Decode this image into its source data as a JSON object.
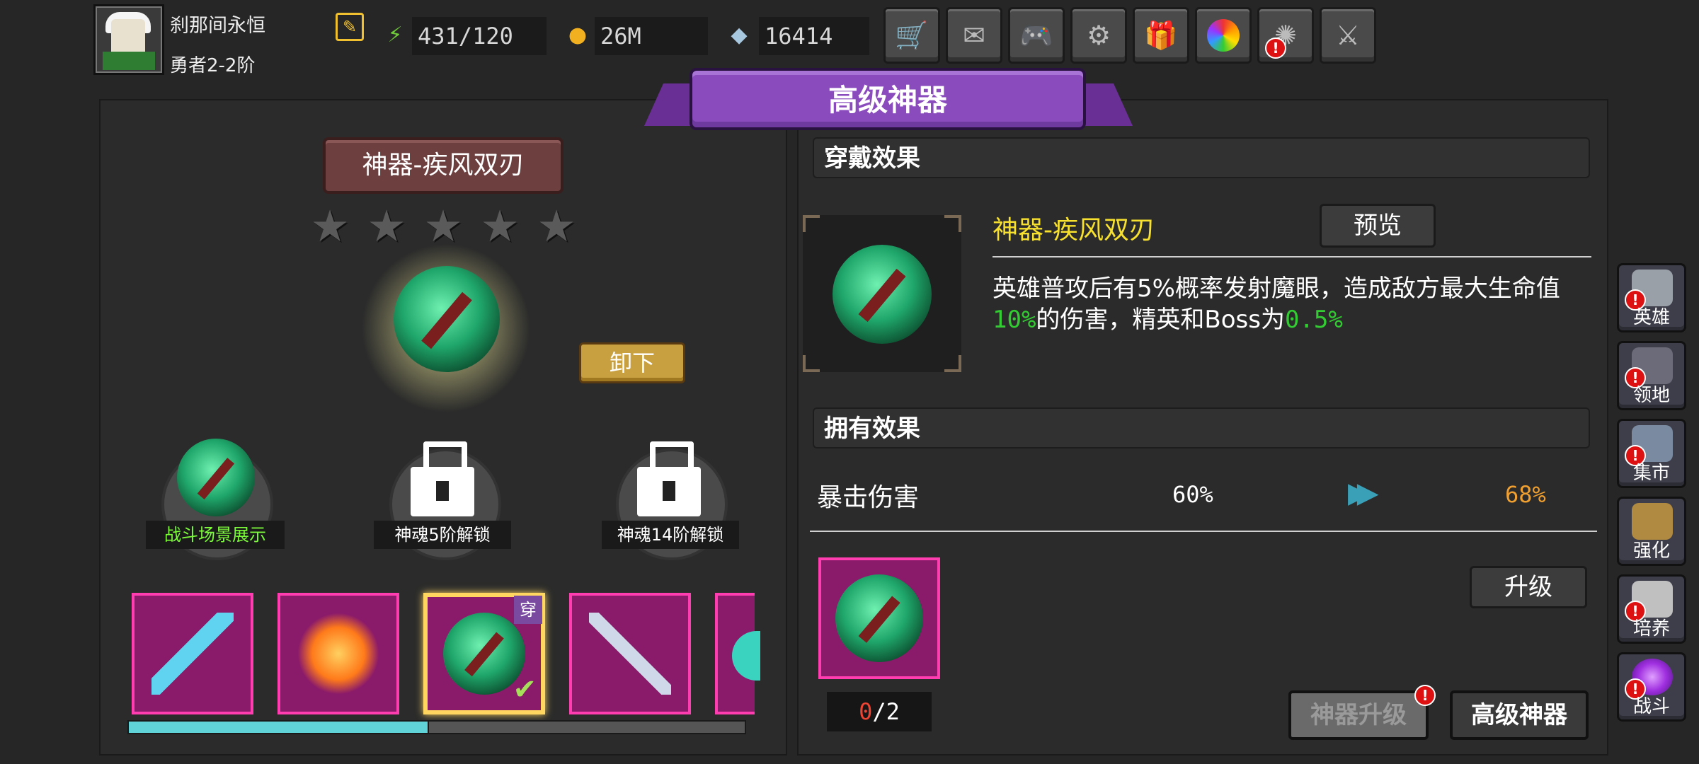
{
  "player": {
    "name": "刹那间永恒",
    "rank": "勇者2-2阶"
  },
  "resources": [
    {
      "icon": "energy-icon",
      "value": "431/120"
    },
    {
      "icon": "gold-coin-icon",
      "value": "26M"
    },
    {
      "icon": "diamond-icon",
      "value": "16414"
    }
  ],
  "toolbar": {
    "buttons": [
      {
        "name": "shop-button",
        "icon": "cart-icon"
      },
      {
        "name": "mail-button",
        "icon": "mail-icon"
      },
      {
        "name": "gamepad-button",
        "icon": "gamepad-icon"
      },
      {
        "name": "settings-button",
        "icon": "gear-icon"
      },
      {
        "name": "gift-button",
        "icon": "gift-icon"
      },
      {
        "name": "gacha-button",
        "icon": "color-wheel-icon"
      },
      {
        "name": "event-button",
        "icon": "firework-icon",
        "alert": true
      },
      {
        "name": "battle-disabled-button",
        "icon": "crossed-swords-icon"
      }
    ],
    "alert_mark": "!"
  },
  "banner": {
    "title": "高级神器"
  },
  "artifact": {
    "name": "神器-疾风双刃",
    "stars": 5,
    "unequip_label": "卸下",
    "slots": [
      {
        "label": "战斗场景展示",
        "locked": false,
        "color": "#7CFC3A"
      },
      {
        "label": "神魂5阶解锁",
        "locked": true,
        "color": "#ffffff"
      },
      {
        "label": "神魂14阶解锁",
        "locked": true,
        "color": "#ffffff"
      }
    ],
    "cards": [
      {
        "name": "ice-sword",
        "color": "#5fd3f0"
      },
      {
        "name": "fire-bow",
        "color": "#ff7a1a"
      },
      {
        "name": "wind-blades",
        "color": "#2fc27a",
        "selected": true,
        "badge": "穿"
      },
      {
        "name": "frost-spear",
        "color": "#9ab6ff"
      },
      {
        "name": "orb",
        "color": "#3ad3c0"
      }
    ],
    "scroll_progress": 0.485
  },
  "wear_effect": {
    "header": "穿戴效果",
    "name": "神器-疾风双刃",
    "preview_label": "预览",
    "desc_prefix": "英雄普攻后有5%概率发射魔眼，造成敌方最大生命值",
    "desc_val1": "10%",
    "desc_mid": "的伤害，精英和Boss为",
    "desc_val2": "0.5%"
  },
  "own_effect": {
    "header": "拥有效果",
    "stat_name": "暴击伤害",
    "current": "60%",
    "next": "68%",
    "upgrade_label": "升级",
    "count_have": "0",
    "count_need": "/2"
  },
  "bottom_buttons": {
    "upgrade": "神器升级",
    "advanced": "高级神器"
  },
  "side_nav": [
    {
      "label": "英雄",
      "icon": "helmet-icon",
      "color": "#9aa0a8",
      "alert": true
    },
    {
      "label": "领地",
      "icon": "castle-icon",
      "color": "#6b6b7a",
      "alert": true
    },
    {
      "label": "集市",
      "icon": "market-icon",
      "color": "#7a8aa0",
      "alert": true
    },
    {
      "label": "强化",
      "icon": "emblem-icon",
      "color": "#b08a40",
      "alert": false
    },
    {
      "label": "培养",
      "icon": "chalice-icon",
      "color": "#c0c0c0",
      "alert": true
    },
    {
      "label": "战斗",
      "icon": "vortex-icon",
      "color": "#a030e0",
      "alert": true
    }
  ]
}
